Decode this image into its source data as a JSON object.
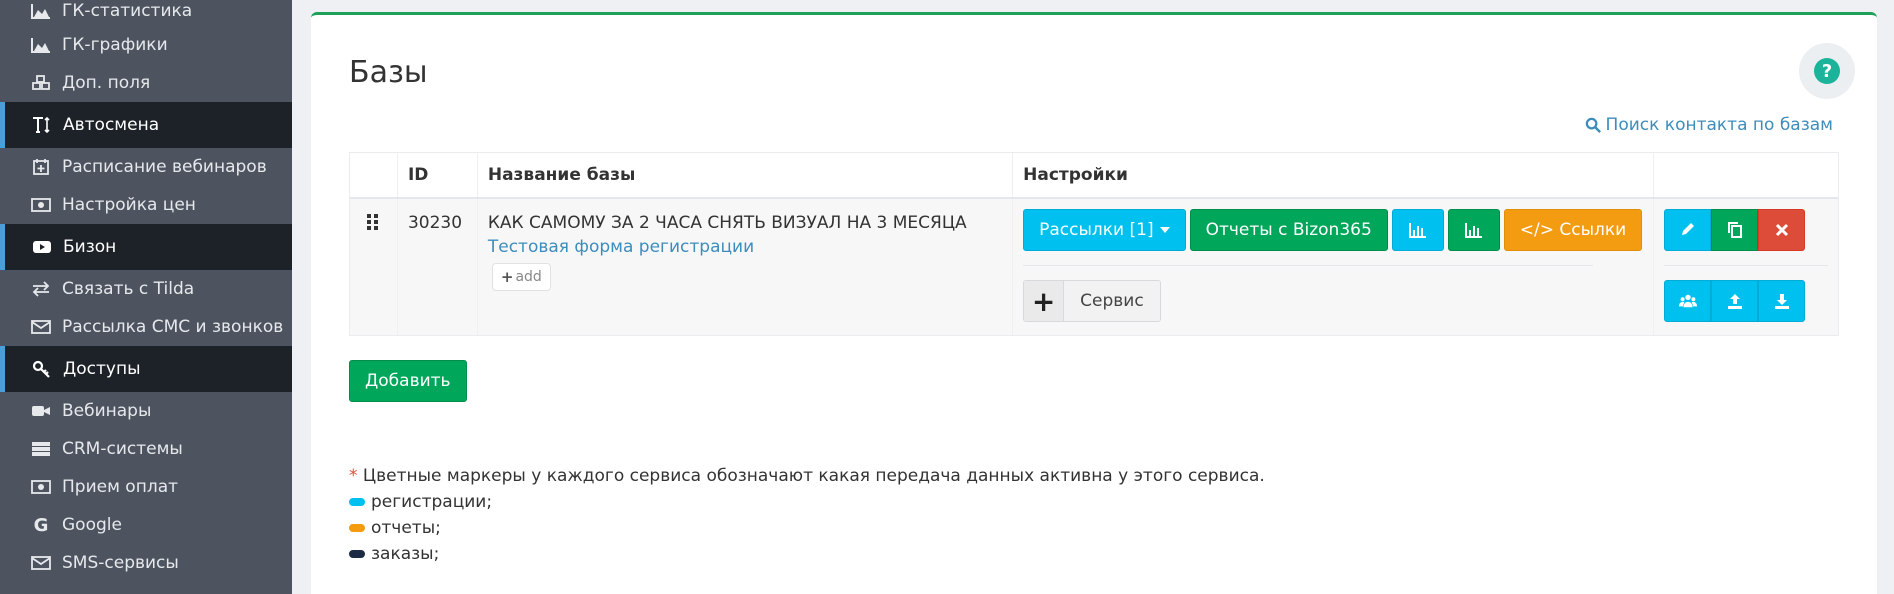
{
  "sidebar": {
    "items": [
      {
        "label": "ГК-статистика",
        "icon": "area-chart-icon",
        "type": "item"
      },
      {
        "label": "ГК-графики",
        "icon": "area-chart-icon",
        "type": "item"
      },
      {
        "label": "Доп. поля",
        "icon": "cubes-icon",
        "type": "item"
      },
      {
        "label": "Автосмена",
        "icon": "text-height-icon",
        "type": "head"
      },
      {
        "label": "Расписание вебинаров",
        "icon": "calendar-plus-icon",
        "type": "item"
      },
      {
        "label": "Настройка цен",
        "icon": "money-icon",
        "type": "item"
      },
      {
        "label": "Бизон",
        "icon": "youtube-play-icon",
        "type": "head"
      },
      {
        "label": "Связать с Tilda",
        "icon": "exchange-icon",
        "type": "item"
      },
      {
        "label": "Рассылка СМС и звонков",
        "icon": "envelope-icon",
        "type": "item"
      },
      {
        "label": "Доступы",
        "icon": "key-icon",
        "type": "head"
      },
      {
        "label": "Вебинары",
        "icon": "video-camera-icon",
        "type": "item"
      },
      {
        "label": "CRM-системы",
        "icon": "server-icon",
        "type": "item"
      },
      {
        "label": "Прием оплат",
        "icon": "money-icon",
        "type": "item"
      },
      {
        "label": "Google",
        "icon": "google-icon",
        "type": "item"
      },
      {
        "label": "SMS-сервисы",
        "icon": "envelope-icon",
        "type": "item"
      }
    ]
  },
  "page": {
    "title": "Базы",
    "search_link": "Поиск контакта по базам",
    "add_button": "Добавить"
  },
  "table": {
    "headers": [
      "",
      "ID",
      "Название базы",
      "Настройки",
      ""
    ],
    "rows": [
      {
        "id": "30230",
        "name": "КАК САМОМУ ЗА 2 ЧАСА СНЯТЬ ВИЗУАЛ НА 3 МЕСЯЦА",
        "form_link": "Тестовая форма регистрации",
        "add_label": "add",
        "mailings_label": "Рассылки [1]",
        "reports_label": "Отчеты с Bizon365",
        "links_label": "</> Ссылки",
        "service_label": "Сервис"
      }
    ]
  },
  "notes": {
    "star": "*",
    "text": "Цветные маркеры у каждого сервиса обозначают какая передача данных активна у этого сервиса.",
    "legend": [
      {
        "label": "регистрации;",
        "color": "#00c0ef"
      },
      {
        "label": "отчеты;",
        "color": "#f39c12"
      },
      {
        "label": "заказы;",
        "color": "#1d2a44"
      }
    ]
  }
}
